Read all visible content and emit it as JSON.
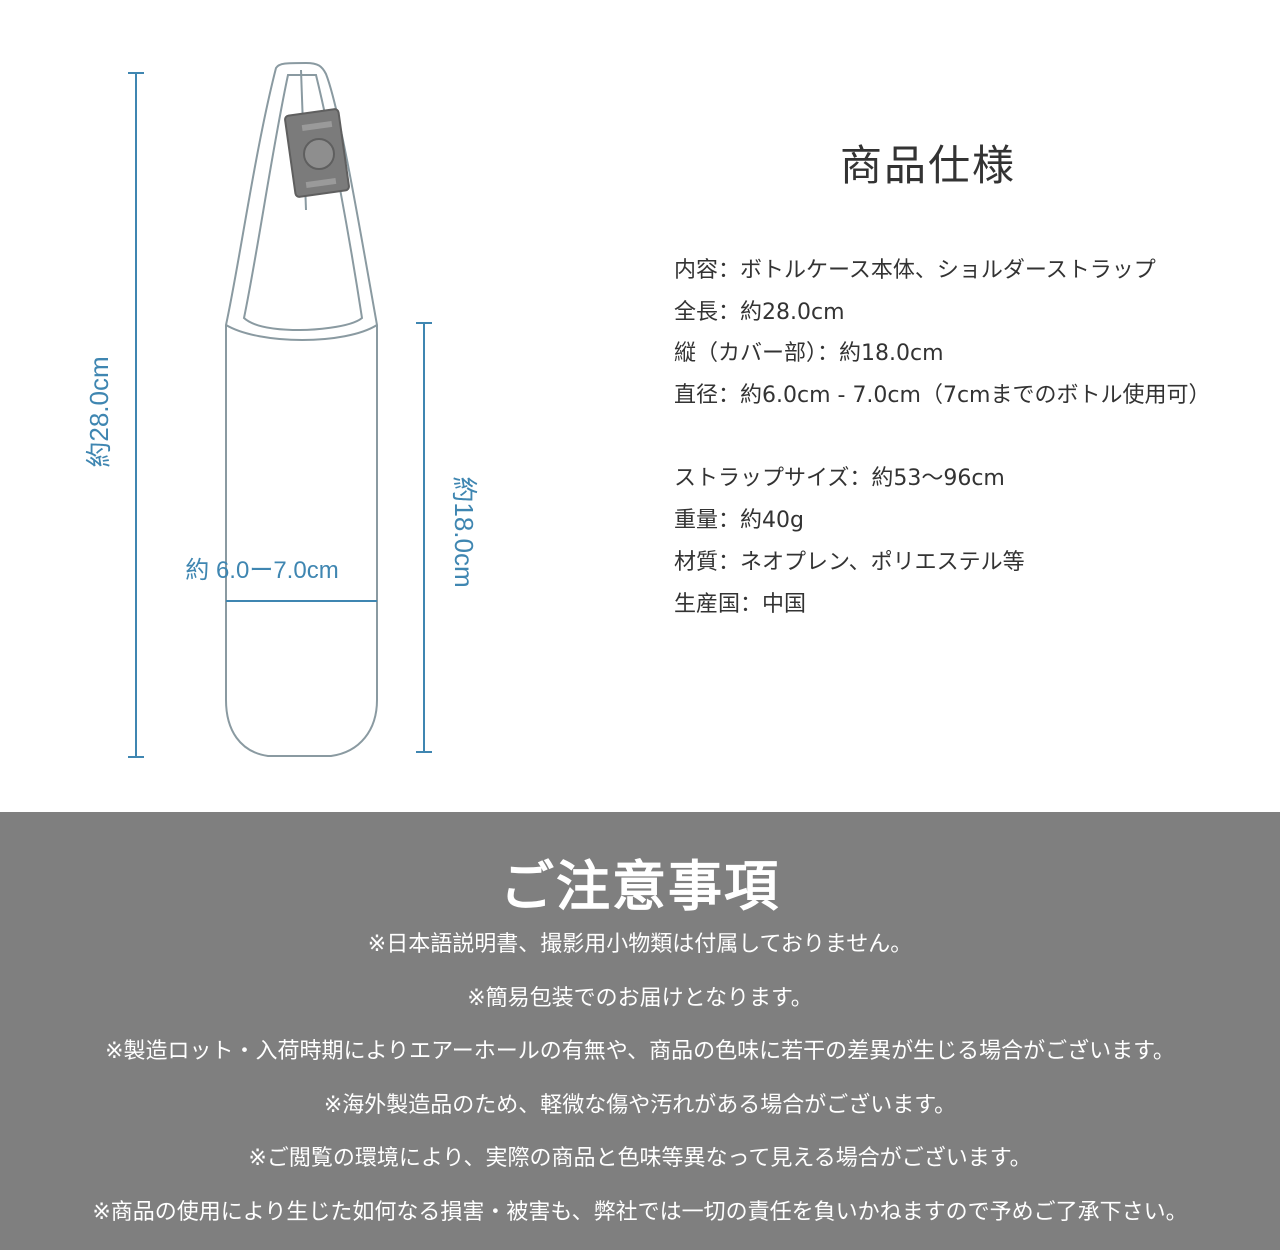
{
  "colors": {
    "dimension_blue": "#3f86b1",
    "outline_gray": "#8a9aa1",
    "buckle_gray": "#7b7b7b",
    "notice_background": "#7f7f7f"
  },
  "diagram": {
    "total_length_label": "約28.0cm",
    "cover_height_label": "約18.0cm",
    "diameter_label": "約 6.0ー7.0cm"
  },
  "spec": {
    "title": "商品仕様",
    "lines": [
      "内容：ボトルケース本体、ショルダーストラップ",
      "全長：約28.0cm",
      "縦（カバー部）：約18.0cm",
      "直径：約6.0cm - 7.0cm（7cmまでのボトル使用可）",
      "ストラップサイズ：約53〜96cm",
      "重量：約40g",
      "材質：ネオプレン、ポリエステル等",
      "生産国：中国"
    ]
  },
  "notice": {
    "title": "ご注意事項",
    "lines": [
      "※日本語説明書、撮影用小物類は付属しておりません。",
      "※簡易包装でのお届けとなります。",
      "※製造ロット・入荷時期によりエアーホールの有無や、商品の色味に若干の差異が生じる場合がございます。",
      "※海外製造品のため、軽微な傷や汚れがある場合がございます。",
      "※ご閲覧の環境により、実際の商品と色味等異なって見える場合がございます。",
      "※商品の使用により生じた如何なる損害・被害も、弊社では一切の責任を負いかねますので予めご了承下さい。"
    ]
  }
}
